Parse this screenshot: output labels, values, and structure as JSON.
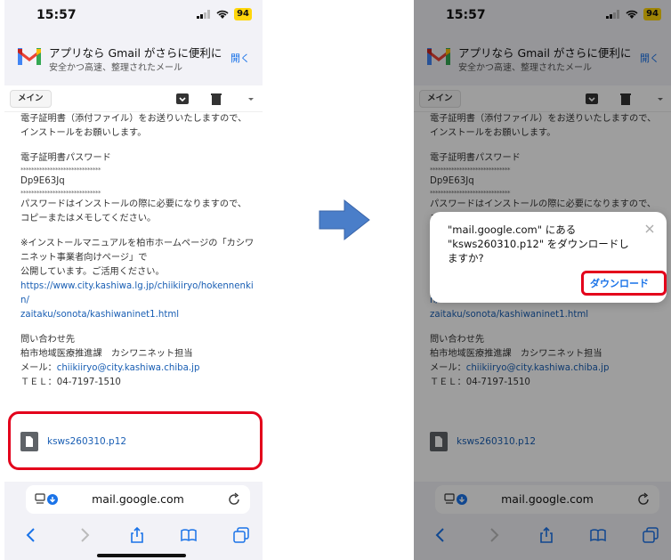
{
  "status": {
    "time": "15:57",
    "battery": "94"
  },
  "banner": {
    "title": "アプリなら Gmail がさらに便利に",
    "subtitle": "安全かつ高速、整理されたメール",
    "open_label": "開く"
  },
  "toolbar": {
    "label_chip": "メイン"
  },
  "email": {
    "lines": [
      "電子証明書（添付ファイル）をお送りいたしますので、",
      "インストールをお願いします。",
      "",
      "電子証明書パスワード",
      "******************************",
      "Dp9E63Jq",
      "******************************",
      "パスワードはインストールの際に必要になりますので、",
      "コピーまたはメモしてください。",
      "",
      "※インストールマニュアルを柏市ホームページの「カシワ",
      "ニネット事業者向けページ」で",
      "公開しています。ご活用ください。"
    ],
    "url_line1": "https://www.city.kashiwa.lg.jp/chiikiiryo/hokennenkin/",
    "url_line2": "zaitaku/sonota/kashiwaninet1.html",
    "contact_heading": "問い合わせ先",
    "contact_dept": "柏市地域医療推進課　カシワニネット担当",
    "contact_mail_label": "メール：",
    "contact_mail": "chiikiiryo@city.kashiwa.chiba.jp",
    "contact_tel": "ＴＥＬ：04-7197-1510"
  },
  "attachment": {
    "filename": "ksws260310.p12"
  },
  "address_bar": {
    "url": "mail.google.com"
  },
  "dialog": {
    "message_line1": "\"mail.google.com\" にある",
    "message_line2": "\"ksws260310.p12\" をダウンロードし",
    "message_line3": "ますか?",
    "download_label": "ダウンロード"
  },
  "colors": {
    "highlight": "#e3001b",
    "link": "#1a5fb4",
    "accent": "#1a73e8",
    "arrow": "#4a7ec9"
  }
}
